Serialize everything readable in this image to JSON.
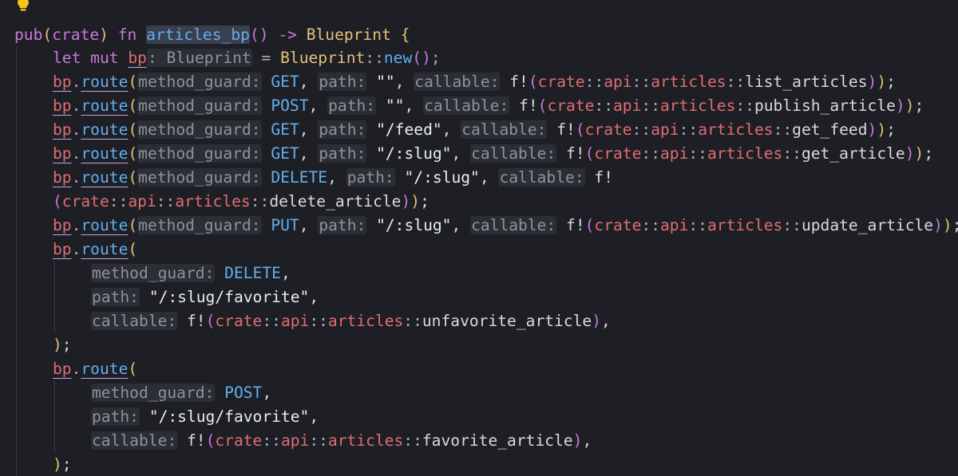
{
  "editor": {
    "language": "rust",
    "lightbulb_icon": "lightbulb-icon",
    "colors": {
      "background": "#1e1f24",
      "keyword": "#c878dc",
      "function": "#61afef",
      "type": "#e5c07b",
      "path_segment": "#e06c75",
      "string": "#e8edf5",
      "inlay_hint_bg": "#2c2e35",
      "inlay_hint_fg": "#8e929c"
    },
    "fn_kw_pub": "pub",
    "fn_kw_crate": "crate",
    "fn_kw_fn": "fn",
    "fn_name": "articles_bp",
    "fn_arrow": "->",
    "fn_return": "Blueprint",
    "let_kw": "let mut",
    "let_var": "bp",
    "let_hint": ": Blueprint",
    "let_eq": " = ",
    "let_type": "Blueprint",
    "let_ctor": "new",
    "close_paren_semi": ");",
    "bp": "bp",
    "route": "route",
    "hint_method_guard": "method_guard:",
    "hint_path": "path:",
    "hint_callable": "callable:",
    "macro": "f!",
    "crate_path": "crate::api::articles::",
    "crate_word": "crate",
    "api_word": "api",
    "articles_word": "articles",
    "routes": [
      {
        "method": "GET",
        "path": "\"\"",
        "handler": "list_articles"
      },
      {
        "method": "POST",
        "path": "\"\"",
        "handler": "publish_article"
      },
      {
        "method": "GET",
        "path": "\"/feed\"",
        "handler": "get_feed"
      },
      {
        "method": "GET",
        "path": "\"/:slug\"",
        "handler": "get_article"
      },
      {
        "method": "DELETE",
        "path": "\"/:slug\"",
        "handler": "delete_article"
      },
      {
        "method": "PUT",
        "path": "\"/:slug\"",
        "handler": "update_article"
      },
      {
        "method": "DELETE",
        "path": "\"/:slug/favorite\"",
        "handler": "unfavorite_article"
      },
      {
        "method": "POST",
        "path": "\"/:slug/favorite\"",
        "handler": "favorite_article"
      }
    ]
  }
}
